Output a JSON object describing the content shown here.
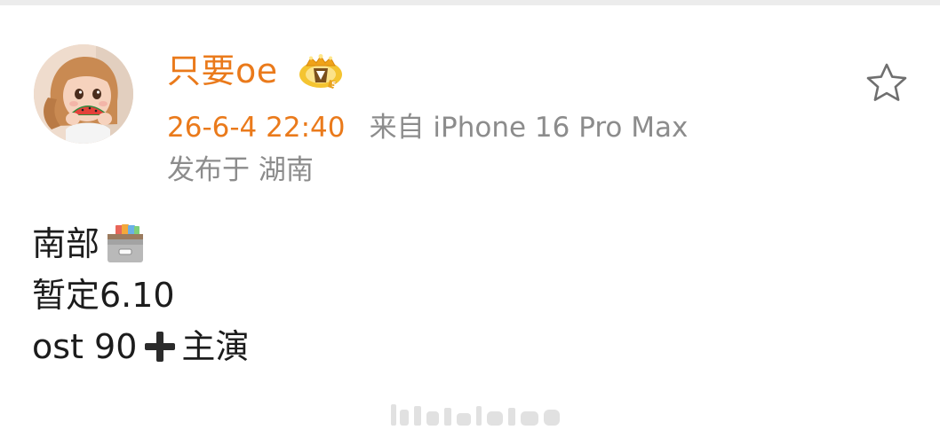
{
  "post": {
    "author": {
      "name": "只要oe",
      "avatar_icon": "girl-eating-watermelon-avatar",
      "badge_icon": "vip-crown-badge-icon"
    },
    "time": "26-6-4 22:40",
    "source": "来自 iPhone 16 Pro Max",
    "location": "发布于 湖南",
    "favorite_icon": "star-outline-icon",
    "content": {
      "line1": "南部",
      "line1_icon": "card-file-box-emoji",
      "line2": "暂定6.10",
      "line3_a": "ost 90",
      "line3_icon": "heavy-plus-sign-emoji",
      "line3_b": "主演"
    }
  },
  "colors": {
    "username": "#ea7a1b",
    "time": "#ea7a1b",
    "meta_gray": "#8c8c8c",
    "body_text": "#1c1c1c",
    "top_band": "#ececec"
  }
}
